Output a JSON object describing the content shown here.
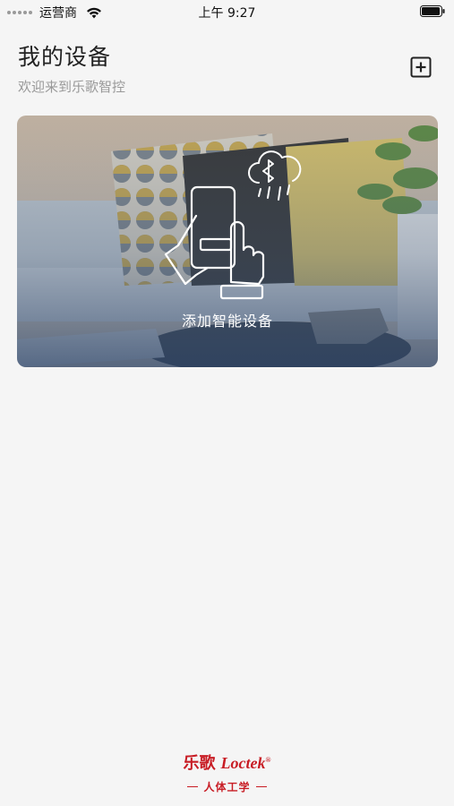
{
  "status_bar": {
    "carrier": "运营商",
    "time": "上午 9:27"
  },
  "header": {
    "title": "我的设备",
    "subtitle": "欢迎来到乐歌智控"
  },
  "card": {
    "label": "添加智能设备"
  },
  "footer": {
    "brand_cn": "乐歌",
    "brand_en": "Loctek",
    "brand_reg": "®",
    "slogan": "人体工学"
  },
  "icons": [
    "signal-dots-icon",
    "wifi-icon",
    "battery-icon",
    "add-icon",
    "phone-touch-icon",
    "bluetooth-cloud-icon"
  ]
}
